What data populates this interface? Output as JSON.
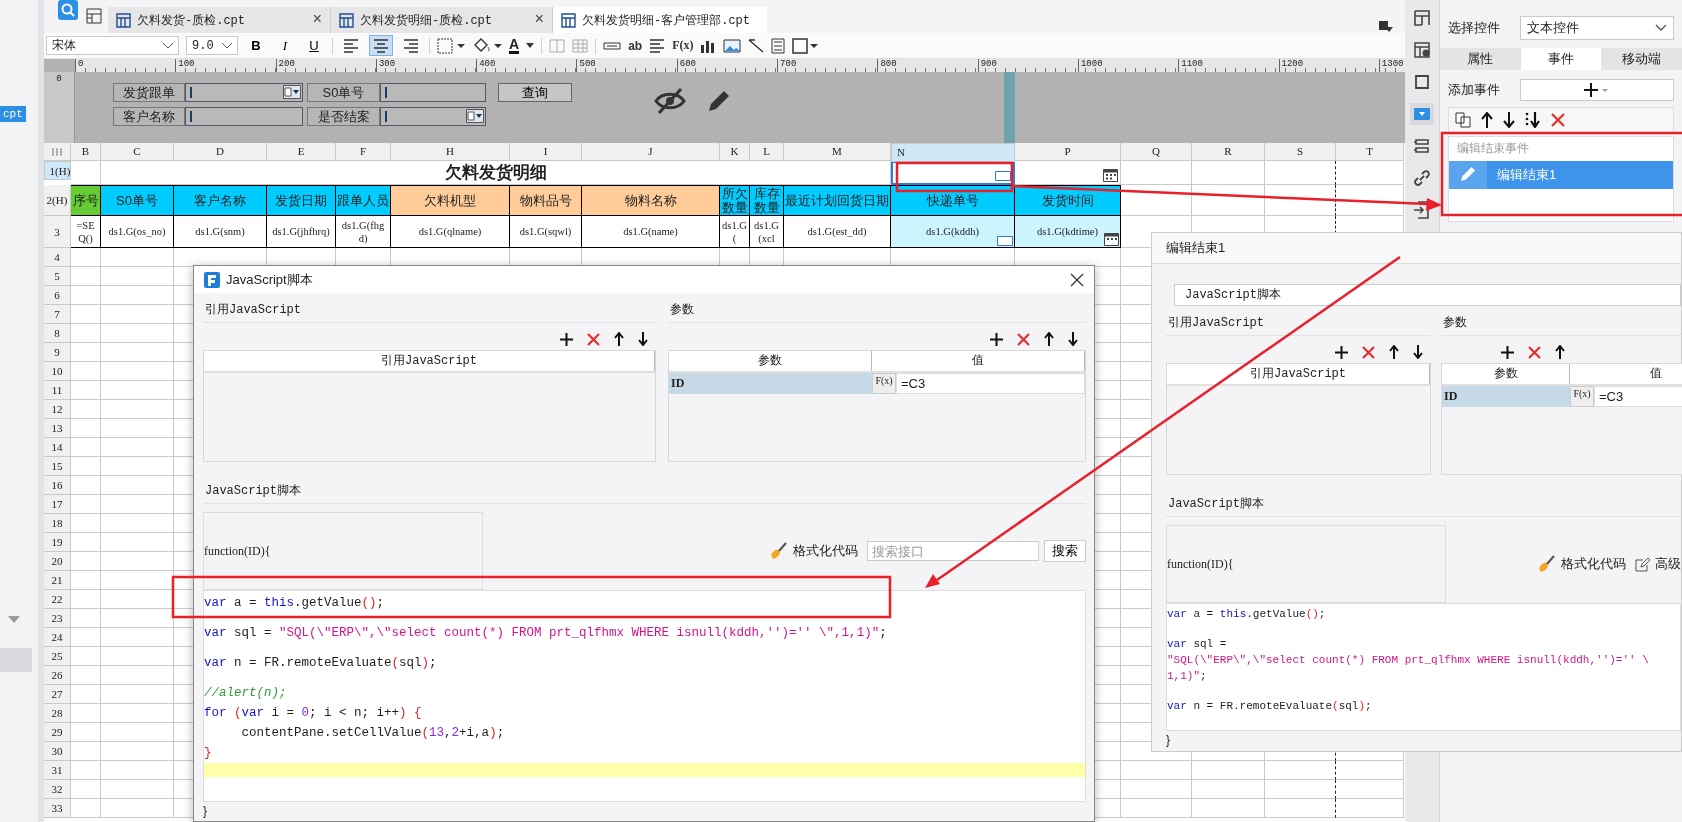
{
  "left_panel": {
    "selected_item": "cpt"
  },
  "tabs": [
    {
      "label": "欠料发货-质检.cpt",
      "selected": false,
      "close": "×"
    },
    {
      "label": "欠料发货明细-质检.cpt",
      "selected": false,
      "close": "×"
    },
    {
      "label": "欠料发货明细-客户管理部.cpt",
      "selected": true
    }
  ],
  "toolbar": {
    "font": "宋体",
    "size": "9.0",
    "bold": "B",
    "italic": "I",
    "underline": "U",
    "align": [
      {
        "selected": false
      },
      {
        "selected": true
      },
      {
        "selected": false
      }
    ],
    "font_color": "A",
    "text_tool": "ab",
    "formula_tool": "F(x)"
  },
  "ruler": {
    "ticks": [
      "0",
      "100",
      "200",
      "300",
      "400",
      "500",
      "600",
      "700",
      "800",
      "900",
      "1000",
      "1100",
      "1200",
      "1300"
    ],
    "side": "0"
  },
  "parameter_pane": {
    "rows": [
      [
        {
          "label": "发货跟单",
          "kind": "combo"
        },
        {
          "label": "S0单号",
          "kind": "text"
        }
      ],
      [
        {
          "label": "客户名称",
          "kind": "text"
        },
        {
          "label": "是否结案",
          "kind": "combo"
        }
      ]
    ],
    "query_button": "查询"
  },
  "sheet": {
    "columns": [
      {
        "letter": "B",
        "selected": false
      },
      {
        "letter": "C",
        "selected": false
      },
      {
        "letter": "D",
        "selected": false
      },
      {
        "letter": "E",
        "selected": false
      },
      {
        "letter": "F",
        "selected": false
      },
      {
        "letter": "H",
        "selected": false
      },
      {
        "letter": "I",
        "selected": false
      },
      {
        "letter": "J",
        "selected": false
      },
      {
        "letter": "K",
        "selected": false
      },
      {
        "letter": "L",
        "selected": false
      },
      {
        "letter": "M",
        "selected": false
      },
      {
        "letter": "N",
        "selected": true
      },
      {
        "letter": "P",
        "selected": false
      },
      {
        "letter": "Q",
        "selected": false
      },
      {
        "letter": "R",
        "selected": false
      },
      {
        "letter": "S",
        "selected": false
      },
      {
        "letter": "T",
        "selected": false
      }
    ],
    "rows": [
      {
        "label": "1(H)",
        "selected": true
      },
      {
        "label": "2(H)",
        "selected": false
      },
      {
        "label": "3",
        "selected": false
      },
      {
        "label": "4",
        "selected": false
      },
      {
        "label": "5",
        "selected": false
      },
      {
        "label": "6",
        "selected": false
      },
      {
        "label": "7",
        "selected": false
      },
      {
        "label": "8",
        "selected": false
      },
      {
        "label": "9",
        "selected": false
      },
      {
        "label": "10",
        "selected": false
      },
      {
        "label": "11",
        "selected": false
      },
      {
        "label": "12",
        "selected": false
      },
      {
        "label": "13",
        "selected": false
      },
      {
        "label": "14",
        "selected": false
      },
      {
        "label": "15",
        "selected": false
      },
      {
        "label": "16",
        "selected": false
      },
      {
        "label": "17",
        "selected": false
      },
      {
        "label": "18",
        "selected": false
      },
      {
        "label": "19",
        "selected": false
      },
      {
        "label": "20",
        "selected": false
      },
      {
        "label": "21",
        "selected": false
      },
      {
        "label": "22",
        "selected": false
      },
      {
        "label": "23",
        "selected": false
      },
      {
        "label": "24",
        "selected": false
      },
      {
        "label": "25",
        "selected": false
      },
      {
        "label": "26",
        "selected": false
      },
      {
        "label": "27",
        "selected": false
      },
      {
        "label": "28",
        "selected": false
      },
      {
        "label": "29",
        "selected": false
      },
      {
        "label": "30",
        "selected": false
      },
      {
        "label": "31",
        "selected": false
      },
      {
        "label": "32",
        "selected": false
      },
      {
        "label": "33",
        "selected": false
      }
    ],
    "title": "欠料发货明细",
    "title_widgets": [
      {
        "kind": "text_widget"
      },
      {
        "kind": "date_widget"
      }
    ],
    "header": [
      {
        "text": "序号",
        "color": "#66cc33"
      },
      {
        "text": "S0单号",
        "color": "#00ccff"
      },
      {
        "text": "客户名称",
        "color": "#00ccff"
      },
      {
        "text": "发货日期",
        "color": "#00ccff"
      },
      {
        "text": "跟单人员",
        "color": "#00ccff"
      },
      {
        "text": "欠料机型",
        "color": "#ffcc99"
      },
      {
        "text": "物料品号",
        "color": "#ffcc99"
      },
      {
        "text": "物料名称",
        "color": "#ffcc99"
      },
      {
        "text": "所欠数量",
        "color": "#00ccff"
      },
      {
        "text": "库存数量",
        "color": "#00ccff"
      },
      {
        "text": "最近计划回货日期",
        "color": "#00ccff"
      },
      {
        "text": "快递单号",
        "color": "#00ccff"
      },
      {
        "text": "发货时间",
        "color": "#00ccff"
      }
    ],
    "formulas": [
      {
        "text": "=SEQ()",
        "color": "#ffffff",
        "kind": "plain"
      },
      {
        "text": "ds1.G(os_no)",
        "color": "#ffffff",
        "kind": "plain"
      },
      {
        "text": "ds1.G(snm)",
        "color": "#ffffff",
        "kind": "plain"
      },
      {
        "text": "ds1.G(jhfhrq)",
        "color": "#ffffff",
        "kind": "plain"
      },
      {
        "text": "ds1.G(fhgd)",
        "color": "#ffffff",
        "kind": "plain"
      },
      {
        "text": "ds1.G(qlname)",
        "color": "#ffffff",
        "kind": "plain"
      },
      {
        "text": "ds1.G(sqwl)",
        "color": "#ffffff",
        "kind": "plain"
      },
      {
        "text": "ds1.G(name)",
        "color": "#ffffff",
        "kind": "plain"
      },
      {
        "text": "ds1.G(",
        "color": "#ffffff",
        "kind": "plain"
      },
      {
        "text": "ds1.G(xcl",
        "color": "#ffffff",
        "kind": "plain"
      },
      {
        "text": "ds1.G(est_dd)",
        "color": "#ffffff",
        "kind": "plain"
      },
      {
        "text": "ds1.G(kddh)",
        "color": "#ccf5ff",
        "kind": "text_widget"
      },
      {
        "text": "ds1.G(kdtime)",
        "color": "#ccf5ff",
        "kind": "date_widget"
      }
    ]
  },
  "side_tools": [
    {
      "kind": "grid",
      "selected": false
    },
    {
      "kind": "info",
      "selected": false
    },
    {
      "kind": "frame",
      "selected": false
    },
    {
      "kind": "dropdown",
      "selected": true
    },
    {
      "kind": "list",
      "selected": false
    },
    {
      "kind": "link",
      "selected": false
    },
    {
      "kind": "import",
      "selected": false
    }
  ],
  "right_panel": {
    "select_label": "选择控件",
    "select_value": "文本控件",
    "tabs": [
      {
        "label": "属性",
        "selected": false
      },
      {
        "label": "事件",
        "selected": true
      },
      {
        "label": "移动端",
        "selected": false
      }
    ],
    "add_event_label": "添加事件",
    "event_group": "编辑结束事件",
    "events": [
      {
        "label": "编辑结束1",
        "selected": true
      }
    ]
  },
  "dialog": {
    "title": "JavaScript脚本",
    "ref_title": "引用JavaScript",
    "ref_column": "引用JavaScript",
    "param_title": "参数",
    "param_columns": [
      "参数",
      "值"
    ],
    "params": [
      {
        "name": "ID",
        "value": "=C3",
        "selected": true
      }
    ],
    "fx_label": "F(x)",
    "script_title": "JavaScript脚本",
    "signature": "function(ID){",
    "format_label": "格式化代码",
    "search_placeholder": "搜索接口",
    "search_button": "搜索",
    "closing": "}",
    "lines": [
      {
        "kind": "code",
        "tokens": [
          {
            "text": "var",
            "kind": "keyword"
          },
          {
            "text": " a = ",
            "kind": "plain"
          },
          {
            "text": "this",
            "kind": "keyword"
          },
          {
            "text": ".getValue",
            "kind": "plain"
          },
          {
            "text": "()",
            "kind": "paren"
          },
          {
            "text": ";",
            "kind": "plain"
          }
        ]
      },
      {
        "kind": "blank"
      },
      {
        "kind": "code",
        "tokens": [
          {
            "text": "var",
            "kind": "keyword"
          },
          {
            "text": " sql = ",
            "kind": "plain"
          },
          {
            "text": "\"SQL(\\\"ERP\\\",\\\"select count(*) FROM prt_qlfhmx WHERE isnull(kddh,'')='' \\\",1,1)\"",
            "kind": "string"
          },
          {
            "text": ";",
            "kind": "plain"
          }
        ]
      },
      {
        "kind": "blank"
      },
      {
        "kind": "code",
        "tokens": [
          {
            "text": "var",
            "kind": "keyword"
          },
          {
            "text": " n = FR.remoteEvaluate",
            "kind": "plain"
          },
          {
            "text": "(",
            "kind": "paren"
          },
          {
            "text": "sql",
            "kind": "plain"
          },
          {
            "text": ")",
            "kind": "paren"
          },
          {
            "text": ";",
            "kind": "plain"
          }
        ]
      },
      {
        "kind": "blank"
      },
      {
        "kind": "code",
        "tokens": [
          {
            "text": "//alert(n);",
            "kind": "comment"
          }
        ]
      },
      {
        "kind": "code",
        "tokens": [
          {
            "text": "for",
            "kind": "keyword"
          },
          {
            "text": " (",
            "kind": "paren"
          },
          {
            "text": "var",
            "kind": "keyword"
          },
          {
            "text": " i = ",
            "kind": "plain"
          },
          {
            "text": "0",
            "kind": "number"
          },
          {
            "text": "; i < n; i++",
            "kind": "plain"
          },
          {
            "text": ")",
            "kind": "paren"
          },
          {
            "text": " {",
            "kind": "paren"
          }
        ]
      },
      {
        "kind": "code",
        "tokens": [
          {
            "text": "     contentPane.setCellValue",
            "kind": "plain"
          },
          {
            "text": "(",
            "kind": "paren"
          },
          {
            "text": "13",
            "kind": "number"
          },
          {
            "text": ",",
            "kind": "plain"
          },
          {
            "text": "2",
            "kind": "number"
          },
          {
            "text": "+i,a",
            "kind": "plain"
          },
          {
            "text": ")",
            "kind": "paren"
          },
          {
            "text": ";",
            "kind": "plain"
          }
        ]
      },
      {
        "kind": "code",
        "tokens": [
          {
            "text": "}",
            "kind": "paren"
          }
        ]
      },
      {
        "kind": "current_line"
      }
    ]
  },
  "event_panel": {
    "title": "编辑结束1",
    "type_value": "JavaScript脚本",
    "ref_title": "引用JavaScript",
    "ref_column": "引用JavaScript",
    "param_title": "参数",
    "param_columns": [
      "参数",
      "值"
    ],
    "params": [
      {
        "name": "ID",
        "value": "=C3",
        "selected": true
      }
    ],
    "fx_label": "F(x)",
    "script_title": "JavaScript脚本",
    "signature": "function(ID){",
    "format_label": "格式化代码",
    "advanced_label": "高级",
    "closing": "}",
    "lines": [
      {
        "kind": "code",
        "tokens": [
          {
            "text": "var",
            "kind": "keyword"
          },
          {
            "text": " a = ",
            "kind": "plain"
          },
          {
            "text": "this",
            "kind": "keyword"
          },
          {
            "text": ".getValue",
            "kind": "plain"
          },
          {
            "text": "()",
            "kind": "paren"
          },
          {
            "text": ";",
            "kind": "plain"
          }
        ]
      },
      {
        "kind": "blank"
      },
      {
        "kind": "code",
        "tokens": [
          {
            "text": "var",
            "kind": "keyword"
          },
          {
            "text": " sql =",
            "kind": "plain"
          }
        ]
      },
      {
        "kind": "code",
        "tokens": [
          {
            "text": "\"SQL(\\\"ERP\\\",\\\"select count(*) FROM prt_qlfhmx WHERE isnull(kddh,'')='' \\",
            "kind": "string"
          }
        ]
      },
      {
        "kind": "code",
        "tokens": [
          {
            "text": "1,1)\"",
            "kind": "string"
          },
          {
            "text": ";",
            "kind": "plain"
          }
        ]
      },
      {
        "kind": "blank"
      },
      {
        "kind": "code",
        "tokens": [
          {
            "text": "var",
            "kind": "keyword"
          },
          {
            "text": " n = FR.remoteEvaluate",
            "kind": "plain"
          },
          {
            "text": "(",
            "kind": "paren"
          },
          {
            "text": "sql",
            "kind": "plain"
          },
          {
            "text": ")",
            "kind": "paren"
          },
          {
            "text": ";",
            "kind": "plain"
          }
        ]
      }
    ]
  }
}
